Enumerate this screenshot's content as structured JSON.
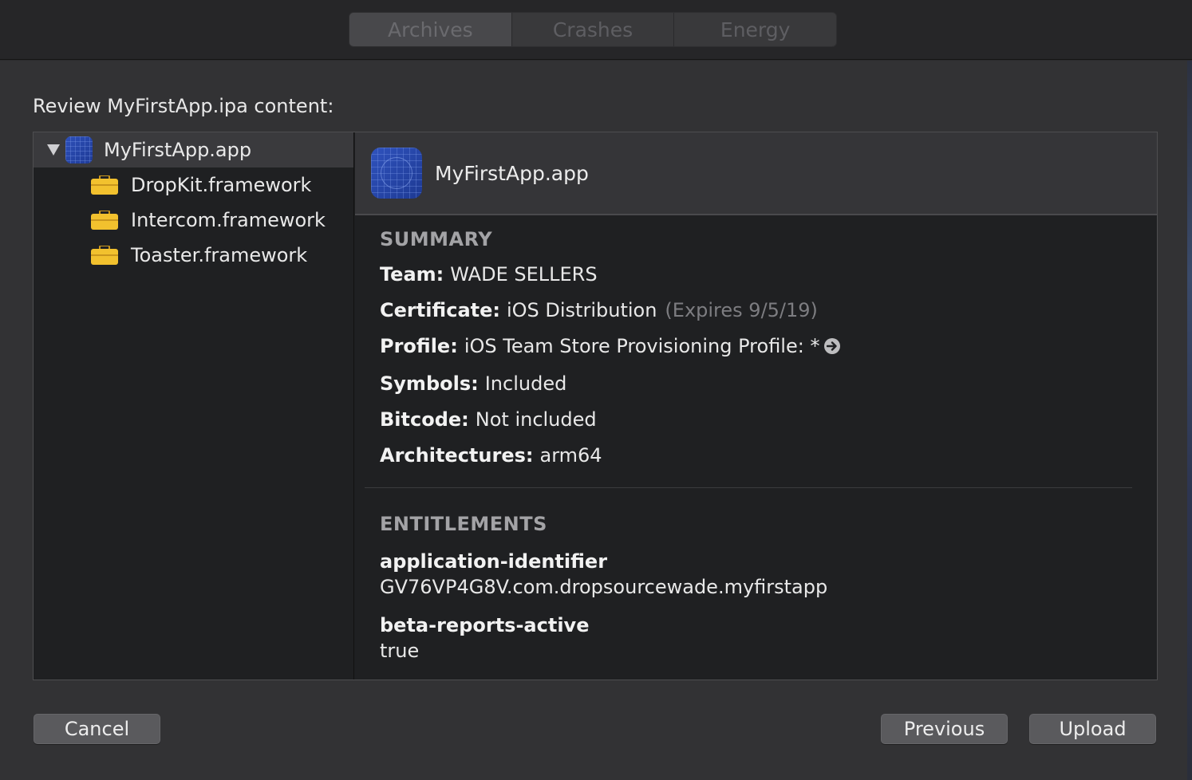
{
  "tabs": [
    {
      "label": "Archives",
      "active": true
    },
    {
      "label": "Crashes",
      "active": false
    },
    {
      "label": "Energy",
      "active": false
    }
  ],
  "heading": "Review MyFirstApp.ipa content:",
  "tree": {
    "root": {
      "label": "MyFirstApp.app",
      "icon": "app-icon",
      "expanded": true
    },
    "children": [
      {
        "label": "DropKit.framework",
        "icon": "briefcase-icon"
      },
      {
        "label": "Intercom.framework",
        "icon": "briefcase-icon"
      },
      {
        "label": "Toaster.framework",
        "icon": "briefcase-icon"
      }
    ]
  },
  "detail": {
    "title": "MyFirstApp.app",
    "summary_title": "SUMMARY",
    "summary": {
      "team_label": "Team:",
      "team_value": "WADE SELLERS",
      "certificate_label": "Certificate:",
      "certificate_value": "iOS Distribution",
      "certificate_expiry": "(Expires 9/5/19)",
      "profile_label": "Profile:",
      "profile_value": "iOS Team Store Provisioning Profile: *",
      "symbols_label": "Symbols:",
      "symbols_value": "Included",
      "bitcode_label": "Bitcode:",
      "bitcode_value": "Not included",
      "architectures_label": "Architectures:",
      "architectures_value": "arm64"
    },
    "entitlements_title": "ENTITLEMENTS",
    "entitlements": [
      {
        "key": "application-identifier",
        "value": "GV76VP4G8V.com.dropsourcewade.myfirstapp"
      },
      {
        "key": "beta-reports-active",
        "value": "true"
      }
    ]
  },
  "buttons": {
    "cancel": "Cancel",
    "previous": "Previous",
    "upload": "Upload"
  },
  "colors": {
    "background": "#323234",
    "panel": "#1f2022",
    "selection": "#3a3a3d",
    "app_icon": "#2d4fb8",
    "briefcase": "#f2c12e"
  }
}
